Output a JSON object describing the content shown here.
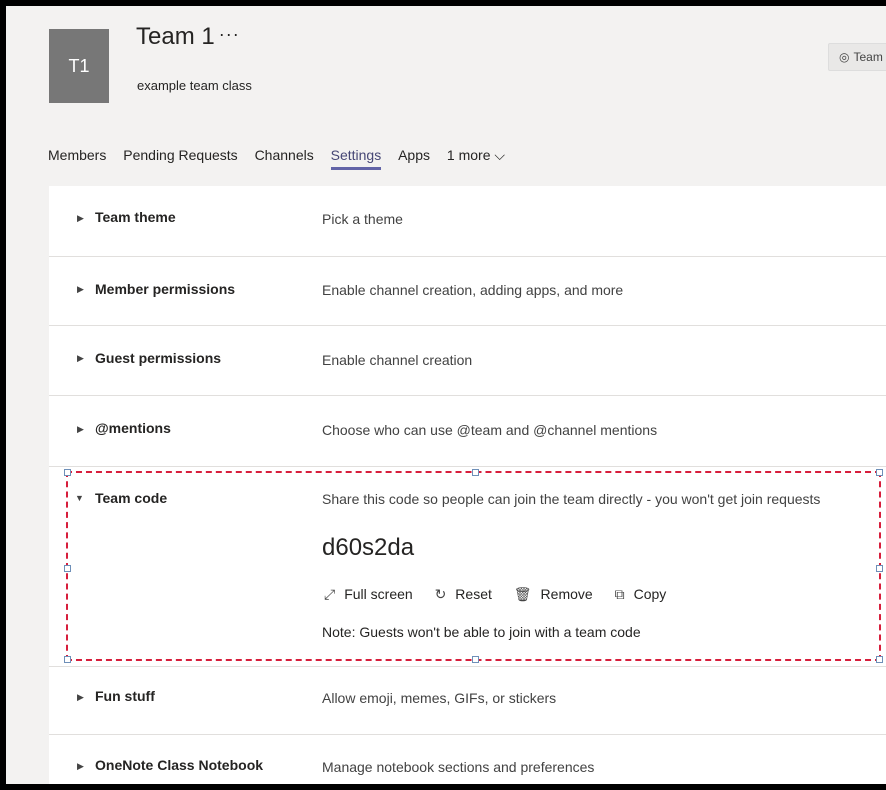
{
  "header": {
    "avatar_initials": "T1",
    "team_name": "Team 1",
    "more_dots": "···",
    "team_description": "example team class",
    "team_button_label": "Team",
    "team_button_icon": "eye-icon"
  },
  "tabs": [
    {
      "label": "Members"
    },
    {
      "label": "Pending Requests"
    },
    {
      "label": "Channels"
    },
    {
      "label": "Settings",
      "active": true
    },
    {
      "label": "Apps"
    },
    {
      "label": "1 more ⌵"
    }
  ],
  "settings": {
    "team_theme": {
      "title": "Team theme",
      "description": "Pick a theme"
    },
    "member_permissions": {
      "title": "Member permissions",
      "description": "Enable channel creation, adding apps, and more"
    },
    "guest_permissions": {
      "title": "Guest permissions",
      "description": "Enable channel creation"
    },
    "mentions": {
      "title": "@mentions",
      "description": "Choose who can use @team and @channel mentions"
    },
    "team_code": {
      "title": "Team code",
      "description": "Share this code so people can join the team directly - you won't get join requests",
      "code": "d60s2da",
      "actions": {
        "full_screen": "Full screen",
        "reset": "Reset",
        "remove": "Remove",
        "copy": "Copy"
      },
      "note": "Note: Guests won't be able to join with a team code"
    },
    "fun_stuff": {
      "title": "Fun stuff",
      "description": "Allow emoji, memes, GIFs, or stickers"
    },
    "onenote": {
      "title": "OneNote Class Notebook",
      "description": "Manage notebook sections and preferences"
    }
  },
  "colors": {
    "accent": "#6264a7",
    "selection_border": "#d71e3c",
    "avatar_bg": "#777777"
  }
}
